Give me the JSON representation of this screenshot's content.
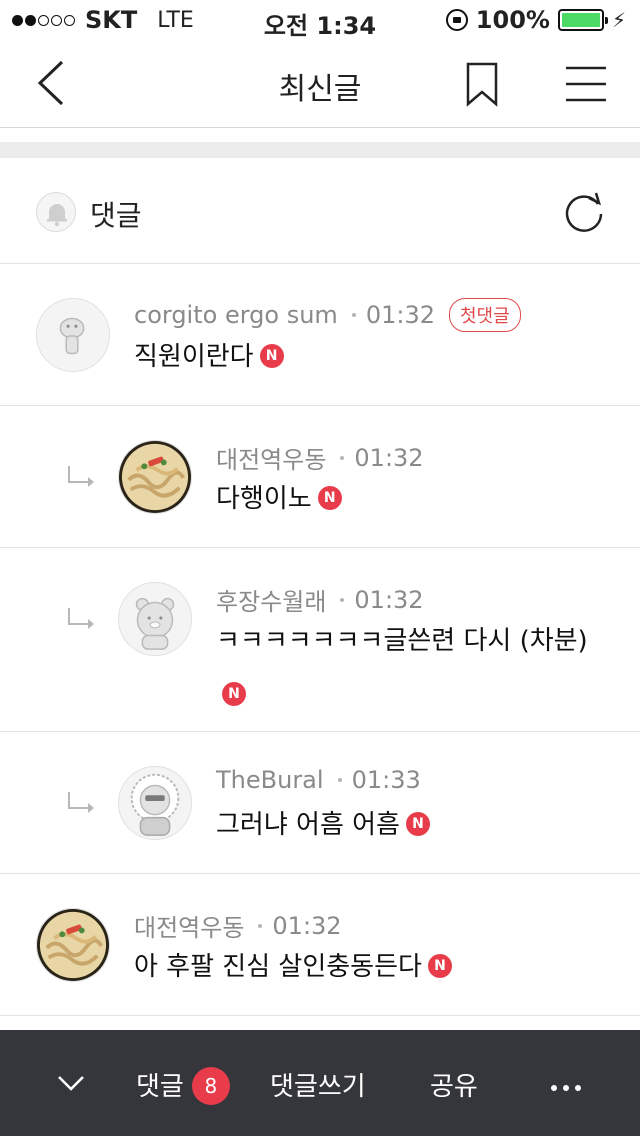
{
  "status_bar": {
    "carrier": "SKT",
    "network": "LTE",
    "time": "오전 1:34",
    "battery": "100%"
  },
  "nav": {
    "title": "최신글"
  },
  "comments_header": {
    "label": "댓글"
  },
  "comments": [
    {
      "author": "corgito ergo sum",
      "time": "01:32",
      "first_badge": "첫댓글",
      "text": "직원이란다",
      "new": "N",
      "reply": false
    },
    {
      "author": "대전역우동",
      "time": "01:32",
      "text": "다행이노",
      "new": "N",
      "reply": true
    },
    {
      "author": "후장수월래",
      "time": "01:32",
      "text": "ㅋㅋㅋㅋㅋㅋㅋ글쓴련 다시 (차분)",
      "new": "N",
      "reply": true
    },
    {
      "author": "TheBural",
      "time": "01:33",
      "text": "그러냐 어흠 어흠",
      "new": "N",
      "reply": true
    },
    {
      "author": "대전역우동",
      "time": "01:32",
      "text": "아 후팔 진심 살인충동든다",
      "new": "N",
      "reply": false
    }
  ],
  "bottom_bar": {
    "comments_label": "댓글",
    "comments_count": "8",
    "write_label": "댓글쓰기",
    "share_label": "공유"
  },
  "colors": {
    "accent_red": "#e83c4b",
    "toolbar_bg": "#35363b",
    "battery_green": "#4cd964"
  },
  "icons": [
    "back-arrow-icon",
    "bookmark-icon",
    "menu-icon",
    "bell-icon",
    "refresh-icon",
    "reply-arrow-icon",
    "chevron-down-icon",
    "more-icon"
  ]
}
